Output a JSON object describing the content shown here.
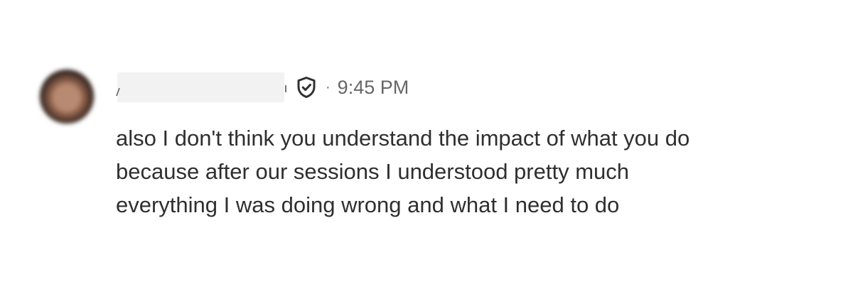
{
  "message": {
    "timestamp_separator": "·",
    "timestamp": "9:45 PM",
    "lines": [
      "also I don't think you understand the impact of what you do",
      "because after our sessions I understood pretty much",
      "everything I was doing wrong and what I need to do"
    ]
  },
  "icons": {
    "verified": "shield-check-icon"
  },
  "colors": {
    "text": "#2f2f2f",
    "muted": "#666666",
    "redaction": "#f2f2f2"
  }
}
